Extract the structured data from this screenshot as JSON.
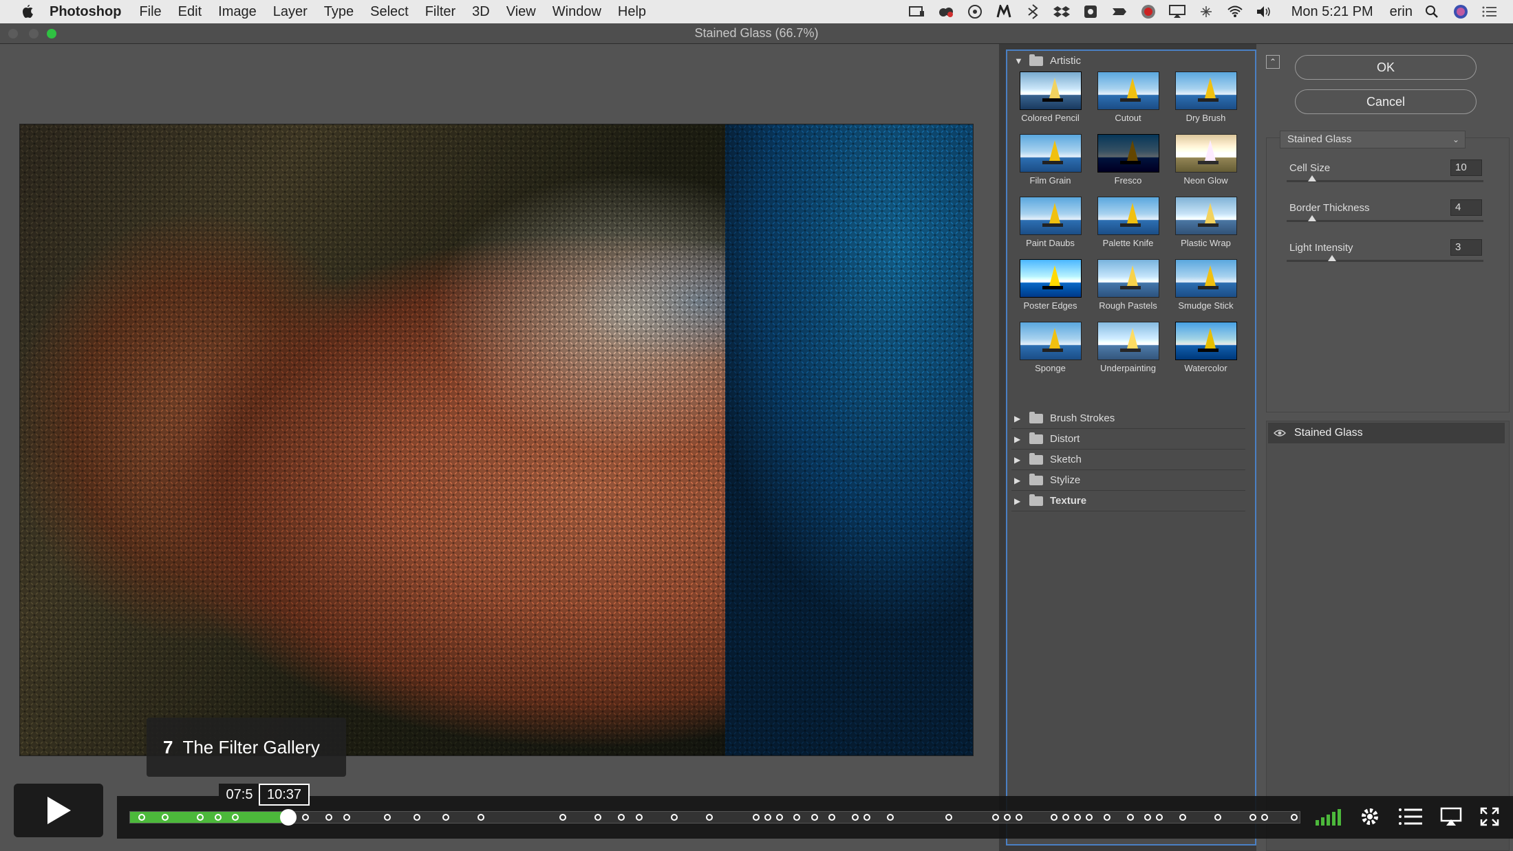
{
  "menubar": {
    "app_name": "Photoshop",
    "items": [
      "File",
      "Edit",
      "Image",
      "Layer",
      "Type",
      "Select",
      "Filter",
      "3D",
      "View",
      "Window",
      "Help"
    ],
    "clock": "Mon 5:21 PM",
    "user": "erin"
  },
  "window": {
    "title": "Stained Glass (66.7%)"
  },
  "filter_gallery": {
    "open_category": "Artistic",
    "thumbnails": [
      "Colored Pencil",
      "Cutout",
      "Dry Brush",
      "Film Grain",
      "Fresco",
      "Neon Glow",
      "Paint Daubs",
      "Palette Knife",
      "Plastic Wrap",
      "Poster Edges",
      "Rough Pastels",
      "Smudge Stick",
      "Sponge",
      "Underpainting",
      "Watercolor"
    ],
    "categories": [
      "Brush Strokes",
      "Distort",
      "Sketch",
      "Stylize",
      "Texture"
    ]
  },
  "settings": {
    "ok_label": "OK",
    "cancel_label": "Cancel",
    "selected_filter": "Stained Glass",
    "params": [
      {
        "label": "Cell Size",
        "value": "10",
        "slider_fraction": 0.13
      },
      {
        "label": "Border Thickness",
        "value": "4",
        "slider_fraction": 0.13
      },
      {
        "label": "Light Intensity",
        "value": "3",
        "slider_fraction": 0.23
      }
    ],
    "layer_name": "Stained Glass"
  },
  "player": {
    "chapter_number": "7",
    "chapter_title": "The Filter Gallery",
    "time_hover": "07:5",
    "time_total": "10:37",
    "progress_fraction": 0.135,
    "chapter_marker_fractions": [
      0.01,
      0.03,
      0.06,
      0.075,
      0.09,
      0.15,
      0.17,
      0.185,
      0.22,
      0.245,
      0.27,
      0.3,
      0.37,
      0.4,
      0.42,
      0.435,
      0.465,
      0.495,
      0.535,
      0.545,
      0.555,
      0.57,
      0.585,
      0.6,
      0.62,
      0.63,
      0.65,
      0.7,
      0.74,
      0.75,
      0.76,
      0.79,
      0.8,
      0.81,
      0.82,
      0.835,
      0.855,
      0.87,
      0.88,
      0.9,
      0.93,
      0.96,
      0.97,
      0.995
    ]
  },
  "colors": {
    "accent_green": "#4cb83b",
    "selection_blue": "#4a80c4"
  },
  "icons": [
    "apple-icon",
    "wifi-icon",
    "volume-icon",
    "search-icon",
    "gear-icon",
    "list-icon",
    "airplay-icon",
    "fullscreen-icon",
    "eye-icon",
    "play-icon"
  ]
}
